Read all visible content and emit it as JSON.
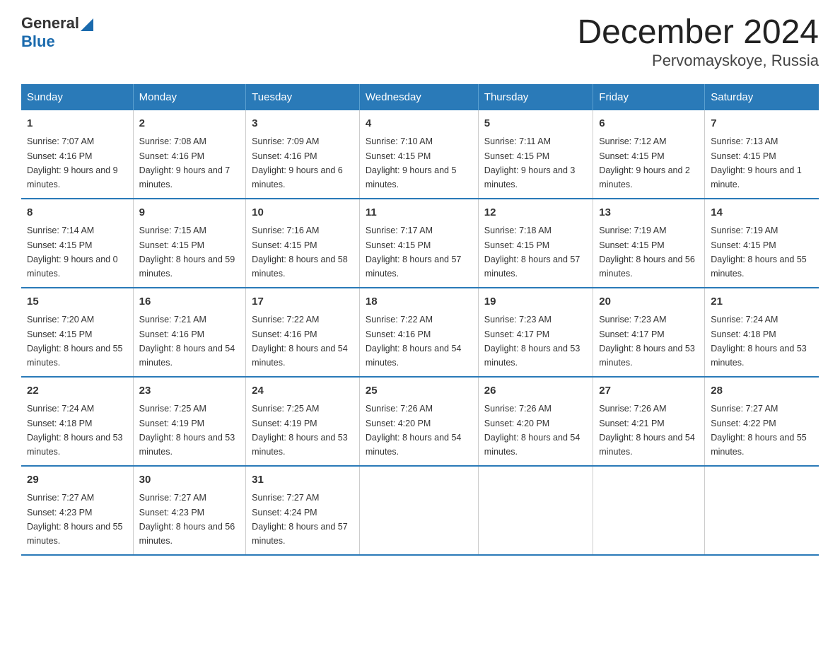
{
  "logo": {
    "general": "General",
    "blue": "Blue",
    "triangle_color": "#1a6aad"
  },
  "title": "December 2024",
  "subtitle": "Pervomayskoye, Russia",
  "days_of_week": [
    "Sunday",
    "Monday",
    "Tuesday",
    "Wednesday",
    "Thursday",
    "Friday",
    "Saturday"
  ],
  "weeks": [
    [
      {
        "num": "1",
        "sunrise": "7:07 AM",
        "sunset": "4:16 PM",
        "daylight": "9 hours and 9 minutes."
      },
      {
        "num": "2",
        "sunrise": "7:08 AM",
        "sunset": "4:16 PM",
        "daylight": "9 hours and 7 minutes."
      },
      {
        "num": "3",
        "sunrise": "7:09 AM",
        "sunset": "4:16 PM",
        "daylight": "9 hours and 6 minutes."
      },
      {
        "num": "4",
        "sunrise": "7:10 AM",
        "sunset": "4:15 PM",
        "daylight": "9 hours and 5 minutes."
      },
      {
        "num": "5",
        "sunrise": "7:11 AM",
        "sunset": "4:15 PM",
        "daylight": "9 hours and 3 minutes."
      },
      {
        "num": "6",
        "sunrise": "7:12 AM",
        "sunset": "4:15 PM",
        "daylight": "9 hours and 2 minutes."
      },
      {
        "num": "7",
        "sunrise": "7:13 AM",
        "sunset": "4:15 PM",
        "daylight": "9 hours and 1 minute."
      }
    ],
    [
      {
        "num": "8",
        "sunrise": "7:14 AM",
        "sunset": "4:15 PM",
        "daylight": "9 hours and 0 minutes."
      },
      {
        "num": "9",
        "sunrise": "7:15 AM",
        "sunset": "4:15 PM",
        "daylight": "8 hours and 59 minutes."
      },
      {
        "num": "10",
        "sunrise": "7:16 AM",
        "sunset": "4:15 PM",
        "daylight": "8 hours and 58 minutes."
      },
      {
        "num": "11",
        "sunrise": "7:17 AM",
        "sunset": "4:15 PM",
        "daylight": "8 hours and 57 minutes."
      },
      {
        "num": "12",
        "sunrise": "7:18 AM",
        "sunset": "4:15 PM",
        "daylight": "8 hours and 57 minutes."
      },
      {
        "num": "13",
        "sunrise": "7:19 AM",
        "sunset": "4:15 PM",
        "daylight": "8 hours and 56 minutes."
      },
      {
        "num": "14",
        "sunrise": "7:19 AM",
        "sunset": "4:15 PM",
        "daylight": "8 hours and 55 minutes."
      }
    ],
    [
      {
        "num": "15",
        "sunrise": "7:20 AM",
        "sunset": "4:15 PM",
        "daylight": "8 hours and 55 minutes."
      },
      {
        "num": "16",
        "sunrise": "7:21 AM",
        "sunset": "4:16 PM",
        "daylight": "8 hours and 54 minutes."
      },
      {
        "num": "17",
        "sunrise": "7:22 AM",
        "sunset": "4:16 PM",
        "daylight": "8 hours and 54 minutes."
      },
      {
        "num": "18",
        "sunrise": "7:22 AM",
        "sunset": "4:16 PM",
        "daylight": "8 hours and 54 minutes."
      },
      {
        "num": "19",
        "sunrise": "7:23 AM",
        "sunset": "4:17 PM",
        "daylight": "8 hours and 53 minutes."
      },
      {
        "num": "20",
        "sunrise": "7:23 AM",
        "sunset": "4:17 PM",
        "daylight": "8 hours and 53 minutes."
      },
      {
        "num": "21",
        "sunrise": "7:24 AM",
        "sunset": "4:18 PM",
        "daylight": "8 hours and 53 minutes."
      }
    ],
    [
      {
        "num": "22",
        "sunrise": "7:24 AM",
        "sunset": "4:18 PM",
        "daylight": "8 hours and 53 minutes."
      },
      {
        "num": "23",
        "sunrise": "7:25 AM",
        "sunset": "4:19 PM",
        "daylight": "8 hours and 53 minutes."
      },
      {
        "num": "24",
        "sunrise": "7:25 AM",
        "sunset": "4:19 PM",
        "daylight": "8 hours and 53 minutes."
      },
      {
        "num": "25",
        "sunrise": "7:26 AM",
        "sunset": "4:20 PM",
        "daylight": "8 hours and 54 minutes."
      },
      {
        "num": "26",
        "sunrise": "7:26 AM",
        "sunset": "4:20 PM",
        "daylight": "8 hours and 54 minutes."
      },
      {
        "num": "27",
        "sunrise": "7:26 AM",
        "sunset": "4:21 PM",
        "daylight": "8 hours and 54 minutes."
      },
      {
        "num": "28",
        "sunrise": "7:27 AM",
        "sunset": "4:22 PM",
        "daylight": "8 hours and 55 minutes."
      }
    ],
    [
      {
        "num": "29",
        "sunrise": "7:27 AM",
        "sunset": "4:23 PM",
        "daylight": "8 hours and 55 minutes."
      },
      {
        "num": "30",
        "sunrise": "7:27 AM",
        "sunset": "4:23 PM",
        "daylight": "8 hours and 56 minutes."
      },
      {
        "num": "31",
        "sunrise": "7:27 AM",
        "sunset": "4:24 PM",
        "daylight": "8 hours and 57 minutes."
      },
      null,
      null,
      null,
      null
    ]
  ]
}
